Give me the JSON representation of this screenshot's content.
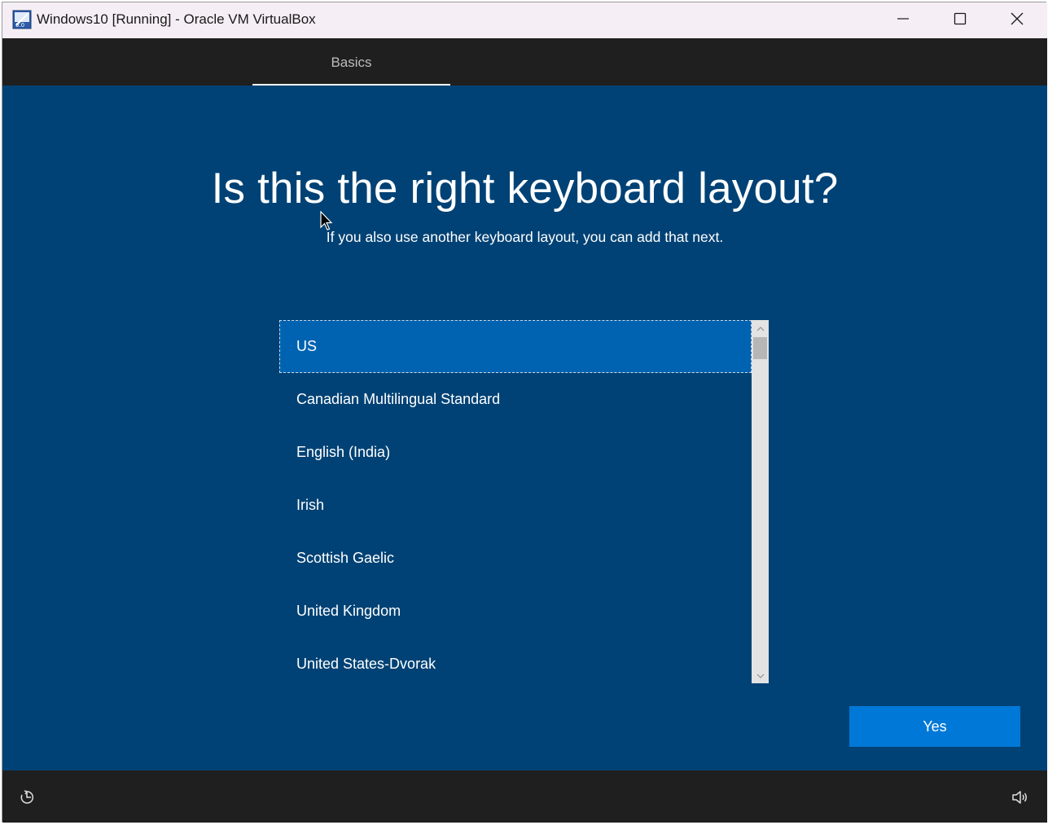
{
  "window": {
    "title": "Windows10 [Running] - Oracle VM VirtualBox",
    "icon": "virtualbox-icon",
    "controls": [
      "minimize-icon",
      "maximize-icon",
      "close-icon"
    ]
  },
  "header": {
    "tabs": [
      {
        "label": "Basics",
        "active": true
      }
    ]
  },
  "main": {
    "heading": "Is this the right keyboard layout?",
    "subheading": "If you also use another keyboard layout, you can add that next.",
    "layouts": [
      {
        "label": "US",
        "selected": true
      },
      {
        "label": "Canadian Multilingual Standard",
        "selected": false
      },
      {
        "label": "English (India)",
        "selected": false
      },
      {
        "label": "Irish",
        "selected": false
      },
      {
        "label": "Scottish Gaelic",
        "selected": false
      },
      {
        "label": "United Kingdom",
        "selected": false
      },
      {
        "label": "United States-Dvorak",
        "selected": false
      }
    ],
    "scroll_position": 0,
    "yes_label": "Yes"
  },
  "footer": {
    "left_icon": "ease-of-access-icon",
    "right_icon": "volume-icon"
  },
  "colors": {
    "background": "#004275",
    "selected_item": "#0063b1",
    "primary_button": "#0078d7",
    "header_bar": "#1f1f1f",
    "titlebar": "#f5eef4"
  }
}
